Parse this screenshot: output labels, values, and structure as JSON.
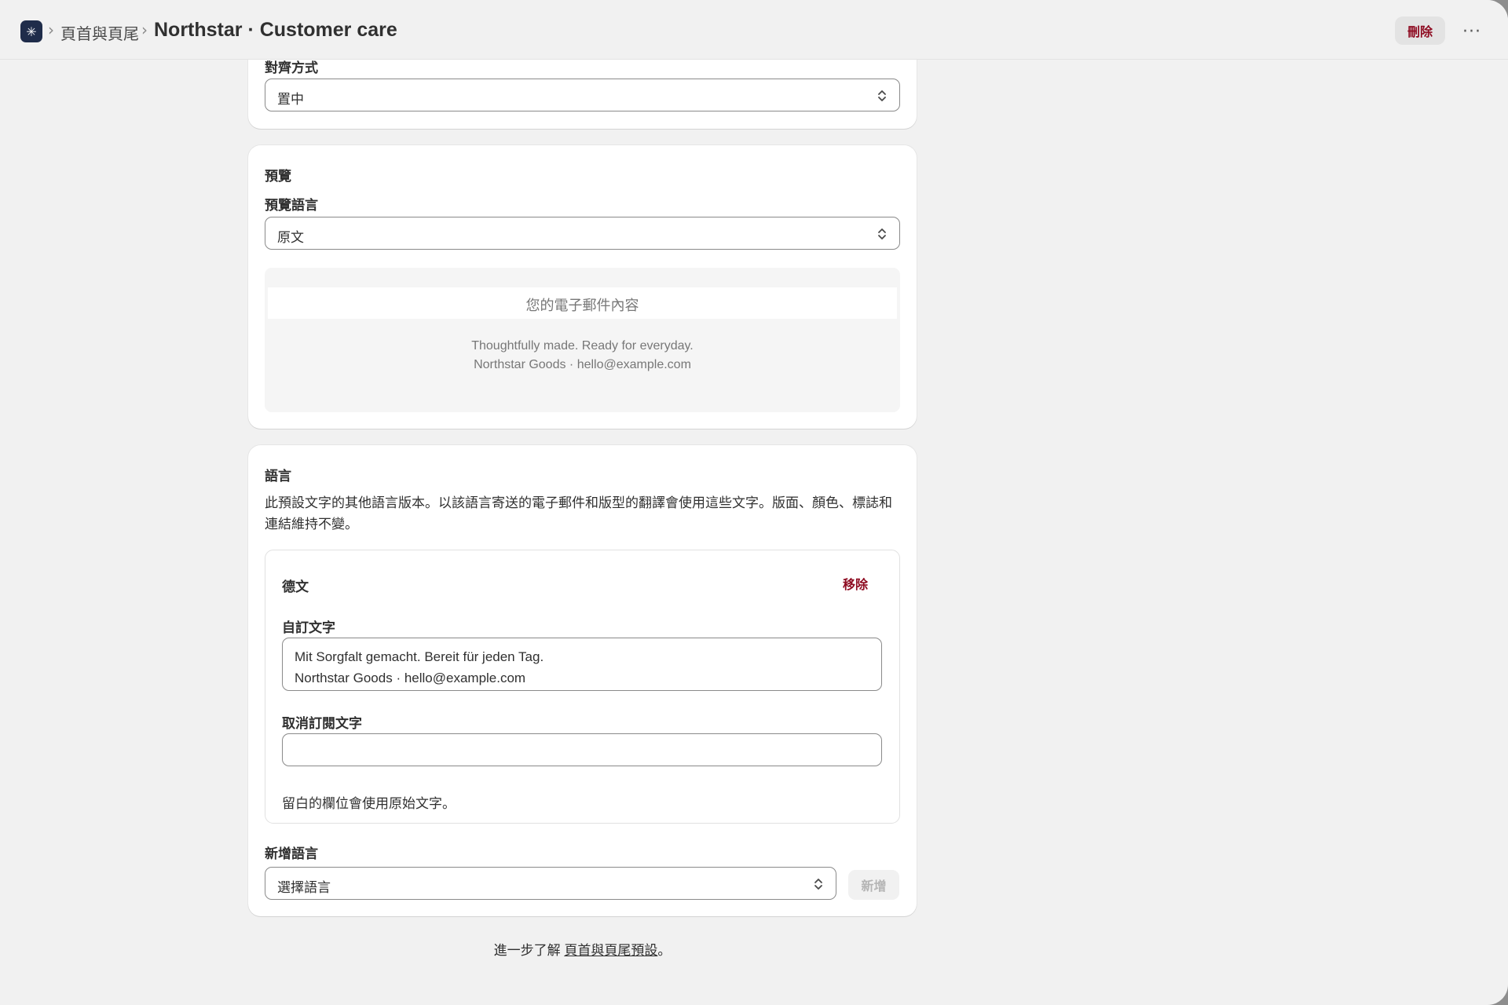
{
  "header": {
    "app_icon": "asterisk-icon",
    "breadcrumb_parent": "頁首與頁尾",
    "title": "Northstar · Customer care",
    "delete_label": "刪除",
    "more_label": "···"
  },
  "alignment_card": {
    "label": "對齊方式",
    "value": "置中"
  },
  "preview_card": {
    "heading": "預覽",
    "language_label": "預覽語言",
    "language_value": "原文",
    "email_body_placeholder": "您的電子郵件內容",
    "footer_line_1": "Thoughtfully made. Ready for everyday.",
    "footer_line_2": "Northstar Goods · hello@example.com"
  },
  "languages_card": {
    "heading": "語言",
    "description": "此預設文字的其他語言版本。以該語言寄送的電子郵件和版型的翻譯會使用這些文字。版面、顏色、標誌和連結維持不變。",
    "entry": {
      "language": "德文",
      "remove_label": "移除",
      "custom_text_label": "自訂文字",
      "custom_text_value": "Mit Sorgfalt gemacht. Bereit für jeden Tag.\nNorthstar Goods · hello@example.com",
      "unsubscribe_label": "取消訂閱文字",
      "unsubscribe_value": "",
      "hint": "留白的欄位會使用原始文字。"
    },
    "add_language_label": "新增語言",
    "add_language_placeholder": "選擇語言",
    "add_button_label": "新增"
  },
  "learn_more": {
    "prefix": "進一步了解 ",
    "link": "頁首與頁尾預設",
    "suffix": "。"
  },
  "colors": {
    "critical": "#8e0b21",
    "app_icon_bg": "#1f2c4a",
    "page_bg": "#f1f1f1"
  }
}
